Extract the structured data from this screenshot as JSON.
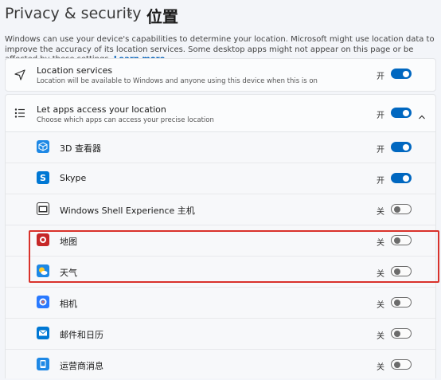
{
  "breadcrumb": {
    "parent": "Privacy & security",
    "separator": "›",
    "current": "位置"
  },
  "description": {
    "text": "Windows can use your device's capabilities to determine your location. Microsoft might use location data to improve the accuracy of its location services. Some desktop apps might not appear on this page or be affected by these settings.",
    "link": "Learn more"
  },
  "location_services": {
    "title": "Location services",
    "subtitle": "Location will be available to Windows and anyone using this device when this is on",
    "state": "开",
    "on": true,
    "icon": "navigation-arrow-icon"
  },
  "apps_access": {
    "title": "Let apps access your location",
    "subtitle": "Choose which apps can access your precise location",
    "state": "开",
    "on": true,
    "icon": "list-icon",
    "expanded": true
  },
  "apps": [
    {
      "name": "3D 查看器",
      "state": "开",
      "on": true,
      "icon": "3d-viewer-icon",
      "color": "#1e88e5"
    },
    {
      "name": "Skype",
      "state": "开",
      "on": true,
      "icon": "skype-icon",
      "color": "#0078d4"
    },
    {
      "name": "Windows Shell Experience 主机",
      "state": "关",
      "on": false,
      "icon": "shell-experience-icon",
      "color": "#333333"
    },
    {
      "name": "地图",
      "state": "关",
      "on": false,
      "icon": "maps-icon",
      "color": "#c62828"
    },
    {
      "name": "天气",
      "state": "关",
      "on": false,
      "icon": "weather-icon",
      "color": "#1e88e5"
    },
    {
      "name": "相机",
      "state": "关",
      "on": false,
      "icon": "camera-icon",
      "color": "#2979ff"
    },
    {
      "name": "邮件和日历",
      "state": "关",
      "on": false,
      "icon": "mail-icon",
      "color": "#0078d4"
    },
    {
      "name": "运营商消息",
      "state": "关",
      "on": false,
      "icon": "carrier-messaging-icon",
      "color": "#1e88e5"
    }
  ],
  "accent_color": "#0067c0",
  "highlight_color": "#d9322b"
}
